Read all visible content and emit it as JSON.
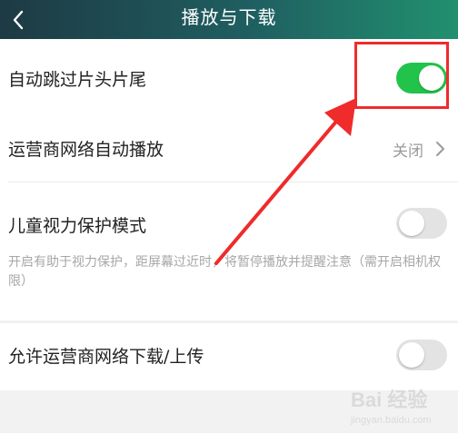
{
  "header": {
    "title": "播放与下载",
    "back_icon": "chevron-left-icon"
  },
  "settings": [
    {
      "label": "自动跳过片头片尾",
      "control": "toggle",
      "enabled": true
    },
    {
      "label": "运营商网络自动播放",
      "control": "link",
      "value": "关闭"
    },
    {
      "label": "儿童视力保护模式",
      "control": "toggle",
      "enabled": false,
      "note": "开启有助于视力保护，距屏幕过近时，将暂停播放并提醒注意（需开启相机权限）"
    },
    {
      "label": "允许运营商网络下载/上传",
      "control": "toggle",
      "enabled": false
    }
  ],
  "colors": {
    "header_start": "#1e3a44",
    "header_end": "#22906f",
    "toggle_on": "#22c34a",
    "toggle_off": "#e3e3e3",
    "annotation": "#ef2b2b"
  },
  "watermark": {
    "text": "Bai 经验",
    "subtext": "jingyan.baidu.com"
  }
}
